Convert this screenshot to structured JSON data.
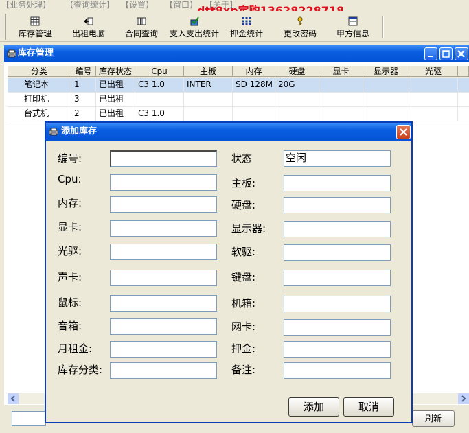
{
  "menu": [
    "【业务处理】",
    "【查询统计】",
    "【设置】",
    "【窗口】",
    "【关于】"
  ],
  "watermark": "dtt8xp定购13628228718",
  "toolbar": [
    {
      "label": "库存管理",
      "icon": "grid-icon"
    },
    {
      "label": "出租电脑",
      "icon": "rent-icon"
    },
    {
      "label": "合同查询",
      "icon": "contract-icon"
    },
    {
      "label": "支入支出统计",
      "icon": "stats-icon"
    },
    {
      "label": "押金统计",
      "icon": "deposit-icon"
    },
    {
      "label": "更改密码",
      "icon": "key-icon"
    },
    {
      "label": "甲方信息",
      "icon": "info-icon"
    }
  ],
  "inventory_window": {
    "title": "库存管理",
    "columns": [
      "分类",
      "编号",
      "库存状态",
      "Cpu",
      "主板",
      "内存",
      "硬盘",
      "显卡",
      "显示器",
      "光驱"
    ],
    "rows": [
      [
        "笔记本",
        "1",
        "已出租",
        "C3 1.0",
        "INTER",
        "SD 128M",
        "20G",
        "",
        "",
        ""
      ],
      [
        "打印机",
        "3",
        "已出租",
        "",
        "",
        "",
        "",
        "",
        "",
        ""
      ],
      [
        "台式机",
        "2",
        "已出租",
        "C3 1.0",
        "",
        "",
        "",
        "",
        "",
        ""
      ]
    ],
    "refresh_label": "刷新"
  },
  "dialog": {
    "title": "添加库存",
    "fields_left": [
      {
        "label": "编号:",
        "value": ""
      },
      {
        "label": "Cpu:",
        "value": ""
      },
      {
        "label": "内存:",
        "value": ""
      },
      {
        "label": "显卡:",
        "value": ""
      },
      {
        "label": "光驱:",
        "value": ""
      },
      {
        "label": "声卡:",
        "value": ""
      },
      {
        "label": "鼠标:",
        "value": ""
      },
      {
        "label": "音箱:",
        "value": ""
      },
      {
        "label": "月租金:",
        "value": ""
      },
      {
        "label": "库存分类:",
        "value": ""
      }
    ],
    "fields_right": [
      {
        "label": "状态",
        "value": "空闲"
      },
      {
        "label": "主板:",
        "value": ""
      },
      {
        "label": "硬盘:",
        "value": ""
      },
      {
        "label": "显示器:",
        "value": ""
      },
      {
        "label": "软驱:",
        "value": ""
      },
      {
        "label": "键盘:",
        "value": ""
      },
      {
        "label": "机箱:",
        "value": ""
      },
      {
        "label": "网卡:",
        "value": ""
      },
      {
        "label": "押金:",
        "value": ""
      },
      {
        "label": "备注:",
        "value": ""
      }
    ],
    "add_label": "添加",
    "cancel_label": "取消"
  }
}
